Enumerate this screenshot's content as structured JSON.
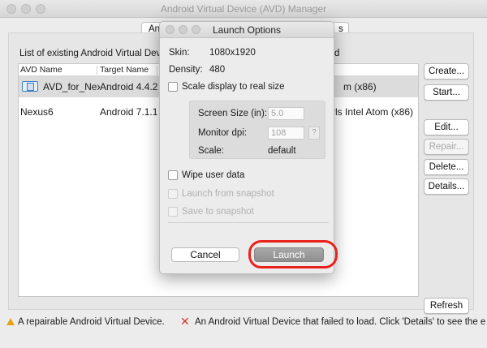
{
  "window": {
    "title": "Android Virtual Device (AVD) Manager",
    "tab_left_fragment": "An",
    "tab_right_fragment": "s"
  },
  "list": {
    "label": "List of existing Android Virtual Devic",
    "label_tail": "d",
    "columns": [
      "AVD Name",
      "Target Name"
    ],
    "rows": [
      {
        "name": "AVD_for_Nex",
        "target": "Android 4.4.2",
        "cpu": "m (x86)",
        "selected": true,
        "icon": "phone-icon"
      },
      {
        "name": "Nexus6",
        "target": "Android 7.1.1",
        "cpu": "Pls Intel Atom (x86)",
        "selected": false,
        "icon": ""
      }
    ]
  },
  "side_buttons": {
    "create": "Create...",
    "start": "Start...",
    "edit": "Edit...",
    "repair": "Repair...",
    "delete": "Delete...",
    "details": "Details...",
    "refresh": "Refresh"
  },
  "legend": {
    "repairable": "A repairable Android Virtual Device.",
    "failed": "An Android Virtual Device that failed to load. Click 'Details' to see the e"
  },
  "dialog": {
    "title": "Launch Options",
    "skin_label": "Skin:",
    "skin_value": "1080x1920",
    "density_label": "Density:",
    "density_value": "480",
    "scale_real_size": "Scale display to real size",
    "screen_size_label": "Screen Size (in):",
    "screen_size_value": "5.0",
    "monitor_dpi_label": "Monitor dpi:",
    "monitor_dpi_value": "108",
    "help": "?",
    "scale_label": "Scale:",
    "scale_value": "default",
    "wipe_user_data": "Wipe user data",
    "launch_from_snapshot": "Launch from snapshot",
    "save_to_snapshot": "Save to snapshot",
    "cancel": "Cancel",
    "launch": "Launch"
  },
  "colors": {
    "highlight_ring": "#e8221c",
    "error_icon": "#d7342c",
    "warning_icon": "#e3a21a",
    "device_icon": "#3b7fc4"
  }
}
